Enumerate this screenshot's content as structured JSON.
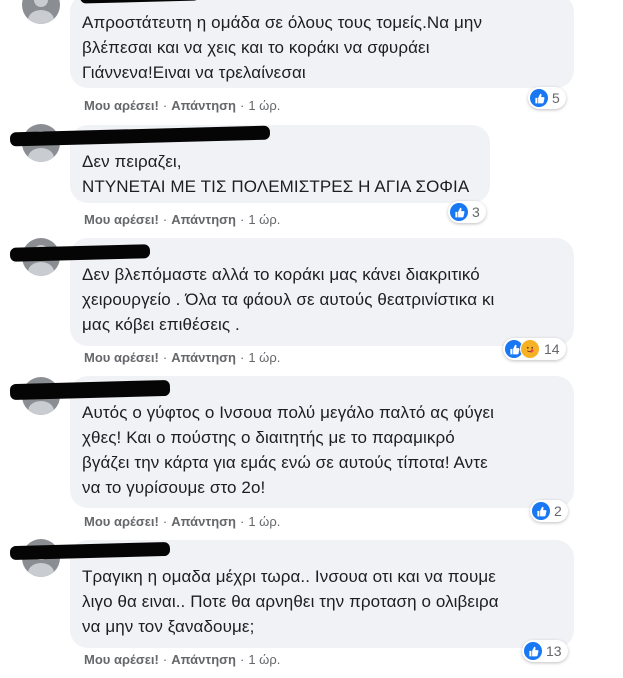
{
  "ui": {
    "like_label": "Μου αρέσει!",
    "reply_label": "Απάντηση",
    "separator": "·"
  },
  "comments": [
    {
      "lines": [
        "Απροστάτευτη η ομάδα σε όλους τους τομείς.Να μην",
        "βλέπεσαι και να χεις και το κοράκι να σφυράει",
        "Γιάννενα!Ειναι να τρελαίνεσαι"
      ],
      "reaction_count": "5",
      "reaction_types": [
        "like-icon"
      ],
      "time": "1 ώρ."
    },
    {
      "lines": [
        "Δεν πειραζει,",
        "ΝΤΥΝΕΤΑΙ ΜΕ ΤΙΣ ΠΟΛΕΜΙΣΤΡΕΣ Η ΑΓΙΑ ΣΟΦΙΑ"
      ],
      "reaction_count": "3",
      "reaction_types": [
        "like-icon"
      ],
      "time": "1 ώρ."
    },
    {
      "lines": [
        "Δεν βλεπόμαστε αλλά το κοράκι μας κάνει διακριτικό",
        "χειρουργείο . Όλα τα φάουλ σε αυτούς θεατρινίστικα κι",
        "μας κόβει επιθέσεις ."
      ],
      "reaction_count": "14",
      "reaction_types": [
        "like-icon",
        "care-icon"
      ],
      "time": "1 ώρ."
    },
    {
      "lines": [
        "Αυτός ο γύφτος ο Ινσουα πολύ μεγάλο παλτό ας φύγει",
        "χθες! Και ο πούστης ο διαιτητής με το παραμικρό",
        "βγάζει την κάρτα για εμάς ενώ σε αυτούς τίποτα! Αντε",
        "να το γυρίσουμε στο 2ο!"
      ],
      "reaction_count": "2",
      "reaction_types": [
        "like-icon"
      ],
      "time": "1 ώρ."
    },
    {
      "lines": [
        "Τραγικη η ομαδα μέχρι τωρα.. Ινσουα οτι και να πουμε",
        "λιγο θα ειναι.. Ποτε θα αρνηθει την προταση ο ολιβειρα",
        "να μην τον ξαναδουμε;"
      ],
      "reaction_count": "13",
      "reaction_types": [
        "like-icon"
      ],
      "time": "1 ώρ."
    }
  ],
  "colors": {
    "bubble_bg": "#f0f2f5",
    "like_blue": "#1877f2",
    "meta_gray": "#65676b",
    "text": "#1c1e21"
  }
}
